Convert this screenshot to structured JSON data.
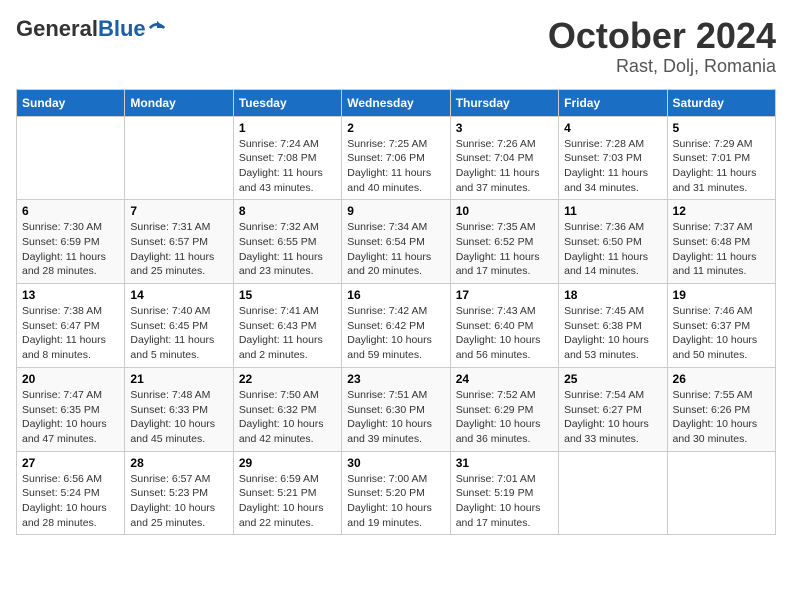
{
  "header": {
    "logo_general": "General",
    "logo_blue": "Blue",
    "title": "October 2024",
    "subtitle": "Rast, Dolj, Romania"
  },
  "calendar": {
    "days_of_week": [
      "Sunday",
      "Monday",
      "Tuesday",
      "Wednesday",
      "Thursday",
      "Friday",
      "Saturday"
    ],
    "weeks": [
      {
        "days": [
          {
            "num": "",
            "info": ""
          },
          {
            "num": "",
            "info": ""
          },
          {
            "num": "1",
            "info": "Sunrise: 7:24 AM\nSunset: 7:08 PM\nDaylight: 11 hours and 43 minutes."
          },
          {
            "num": "2",
            "info": "Sunrise: 7:25 AM\nSunset: 7:06 PM\nDaylight: 11 hours and 40 minutes."
          },
          {
            "num": "3",
            "info": "Sunrise: 7:26 AM\nSunset: 7:04 PM\nDaylight: 11 hours and 37 minutes."
          },
          {
            "num": "4",
            "info": "Sunrise: 7:28 AM\nSunset: 7:03 PM\nDaylight: 11 hours and 34 minutes."
          },
          {
            "num": "5",
            "info": "Sunrise: 7:29 AM\nSunset: 7:01 PM\nDaylight: 11 hours and 31 minutes."
          }
        ]
      },
      {
        "days": [
          {
            "num": "6",
            "info": "Sunrise: 7:30 AM\nSunset: 6:59 PM\nDaylight: 11 hours and 28 minutes."
          },
          {
            "num": "7",
            "info": "Sunrise: 7:31 AM\nSunset: 6:57 PM\nDaylight: 11 hours and 25 minutes."
          },
          {
            "num": "8",
            "info": "Sunrise: 7:32 AM\nSunset: 6:55 PM\nDaylight: 11 hours and 23 minutes."
          },
          {
            "num": "9",
            "info": "Sunrise: 7:34 AM\nSunset: 6:54 PM\nDaylight: 11 hours and 20 minutes."
          },
          {
            "num": "10",
            "info": "Sunrise: 7:35 AM\nSunset: 6:52 PM\nDaylight: 11 hours and 17 minutes."
          },
          {
            "num": "11",
            "info": "Sunrise: 7:36 AM\nSunset: 6:50 PM\nDaylight: 11 hours and 14 minutes."
          },
          {
            "num": "12",
            "info": "Sunrise: 7:37 AM\nSunset: 6:48 PM\nDaylight: 11 hours and 11 minutes."
          }
        ]
      },
      {
        "days": [
          {
            "num": "13",
            "info": "Sunrise: 7:38 AM\nSunset: 6:47 PM\nDaylight: 11 hours and 8 minutes."
          },
          {
            "num": "14",
            "info": "Sunrise: 7:40 AM\nSunset: 6:45 PM\nDaylight: 11 hours and 5 minutes."
          },
          {
            "num": "15",
            "info": "Sunrise: 7:41 AM\nSunset: 6:43 PM\nDaylight: 11 hours and 2 minutes."
          },
          {
            "num": "16",
            "info": "Sunrise: 7:42 AM\nSunset: 6:42 PM\nDaylight: 10 hours and 59 minutes."
          },
          {
            "num": "17",
            "info": "Sunrise: 7:43 AM\nSunset: 6:40 PM\nDaylight: 10 hours and 56 minutes."
          },
          {
            "num": "18",
            "info": "Sunrise: 7:45 AM\nSunset: 6:38 PM\nDaylight: 10 hours and 53 minutes."
          },
          {
            "num": "19",
            "info": "Sunrise: 7:46 AM\nSunset: 6:37 PM\nDaylight: 10 hours and 50 minutes."
          }
        ]
      },
      {
        "days": [
          {
            "num": "20",
            "info": "Sunrise: 7:47 AM\nSunset: 6:35 PM\nDaylight: 10 hours and 47 minutes."
          },
          {
            "num": "21",
            "info": "Sunrise: 7:48 AM\nSunset: 6:33 PM\nDaylight: 10 hours and 45 minutes."
          },
          {
            "num": "22",
            "info": "Sunrise: 7:50 AM\nSunset: 6:32 PM\nDaylight: 10 hours and 42 minutes."
          },
          {
            "num": "23",
            "info": "Sunrise: 7:51 AM\nSunset: 6:30 PM\nDaylight: 10 hours and 39 minutes."
          },
          {
            "num": "24",
            "info": "Sunrise: 7:52 AM\nSunset: 6:29 PM\nDaylight: 10 hours and 36 minutes."
          },
          {
            "num": "25",
            "info": "Sunrise: 7:54 AM\nSunset: 6:27 PM\nDaylight: 10 hours and 33 minutes."
          },
          {
            "num": "26",
            "info": "Sunrise: 7:55 AM\nSunset: 6:26 PM\nDaylight: 10 hours and 30 minutes."
          }
        ]
      },
      {
        "days": [
          {
            "num": "27",
            "info": "Sunrise: 6:56 AM\nSunset: 5:24 PM\nDaylight: 10 hours and 28 minutes."
          },
          {
            "num": "28",
            "info": "Sunrise: 6:57 AM\nSunset: 5:23 PM\nDaylight: 10 hours and 25 minutes."
          },
          {
            "num": "29",
            "info": "Sunrise: 6:59 AM\nSunset: 5:21 PM\nDaylight: 10 hours and 22 minutes."
          },
          {
            "num": "30",
            "info": "Sunrise: 7:00 AM\nSunset: 5:20 PM\nDaylight: 10 hours and 19 minutes."
          },
          {
            "num": "31",
            "info": "Sunrise: 7:01 AM\nSunset: 5:19 PM\nDaylight: 10 hours and 17 minutes."
          },
          {
            "num": "",
            "info": ""
          },
          {
            "num": "",
            "info": ""
          }
        ]
      }
    ]
  }
}
